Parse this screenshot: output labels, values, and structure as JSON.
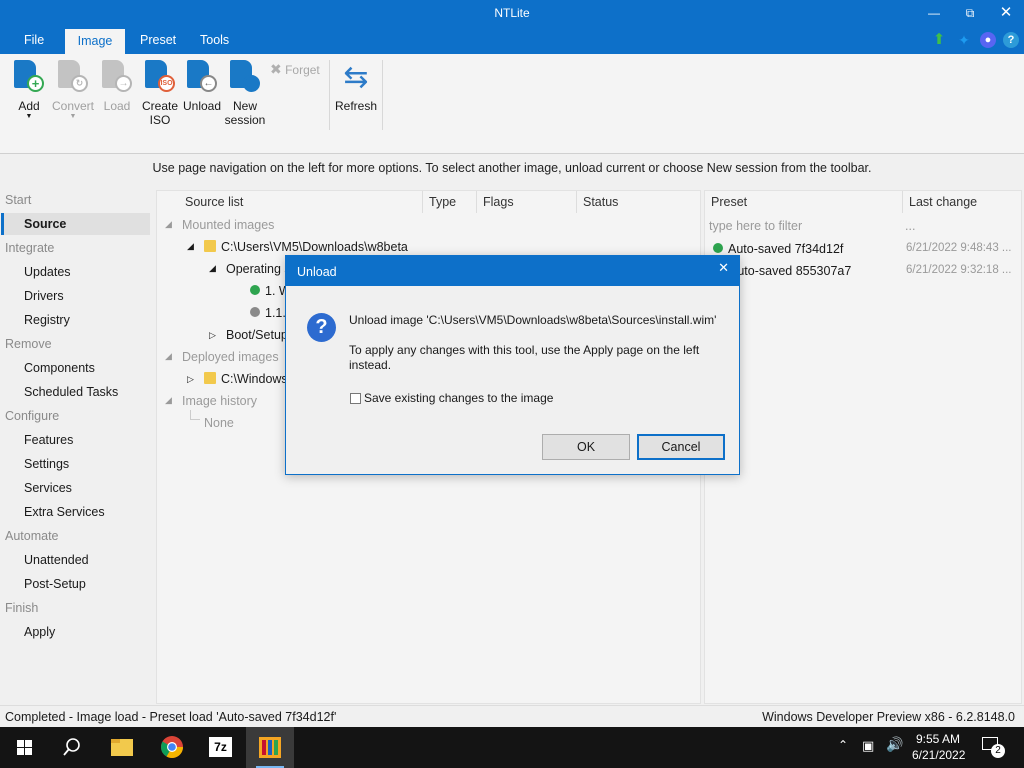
{
  "window": {
    "title": "NTLite"
  },
  "menu": {
    "tabs": [
      "File",
      "Image",
      "Preset",
      "Tools"
    ]
  },
  "ribbon": {
    "add": "Add",
    "convert": "Convert",
    "load": "Load",
    "create_iso_1": "Create",
    "create_iso_2": "ISO",
    "unload": "Unload",
    "new_session_1": "New",
    "new_session_2": "session",
    "forget": "Forget",
    "refresh": "Refresh"
  },
  "info_text": "Use page navigation on the left for more options. To select another image, unload current or choose New session from the toolbar.",
  "nav": {
    "start": "Start",
    "source": "Source",
    "integrate": "Integrate",
    "updates": "Updates",
    "drivers": "Drivers",
    "registry": "Registry",
    "remove": "Remove",
    "components": "Components",
    "scheduled_tasks": "Scheduled Tasks",
    "configure": "Configure",
    "features": "Features",
    "settings": "Settings",
    "services": "Services",
    "extra_services": "Extra Services",
    "automate": "Automate",
    "unattended": "Unattended",
    "post_setup": "Post-Setup",
    "finish": "Finish",
    "apply": "Apply"
  },
  "source_list": {
    "columns": [
      "Source list",
      "Type",
      "Flags",
      "Status"
    ],
    "mounted_images": "Mounted images",
    "mounted_path": "C:\\Users\\VM5\\Downloads\\w8beta",
    "operating": "Operating s",
    "item1": "1. W",
    "item2": "1.1.",
    "boot_setup": "Boot/Setup",
    "deployed_images": "Deployed images",
    "deployed_path": "C:\\Windows",
    "image_history": "Image history",
    "none": "None"
  },
  "presets": {
    "columns": [
      "Preset",
      "Last change"
    ],
    "filter_placeholder": "type here to filter",
    "filter_more": "...",
    "rows": [
      {
        "name": "Auto-saved 7f34d12f",
        "time": "6/21/2022 9:48:43 ..."
      },
      {
        "name": "Auto-saved 855307a7",
        "time": "6/21/2022 9:32:18 ..."
      }
    ]
  },
  "status": {
    "left": "Completed - Image load - Preset load 'Auto-saved 7f34d12f'",
    "right": "Windows Developer Preview x86 - 6.2.8148.0"
  },
  "dialog": {
    "title": "Unload",
    "message": "Unload image 'C:\\Users\\VM5\\Downloads\\w8beta\\Sources\\install.wim'",
    "note": "To apply any changes with this tool, use the Apply page on the left instead.",
    "checkbox": "Save existing changes to the image",
    "ok": "OK",
    "cancel": "Cancel"
  },
  "taskbar": {
    "time": "9:55 AM",
    "date": "6/21/2022",
    "notifications": "2",
    "sevenzip_label": "7z"
  },
  "colors": {
    "accent": "#0d70c9",
    "green": "#2ea44f"
  }
}
